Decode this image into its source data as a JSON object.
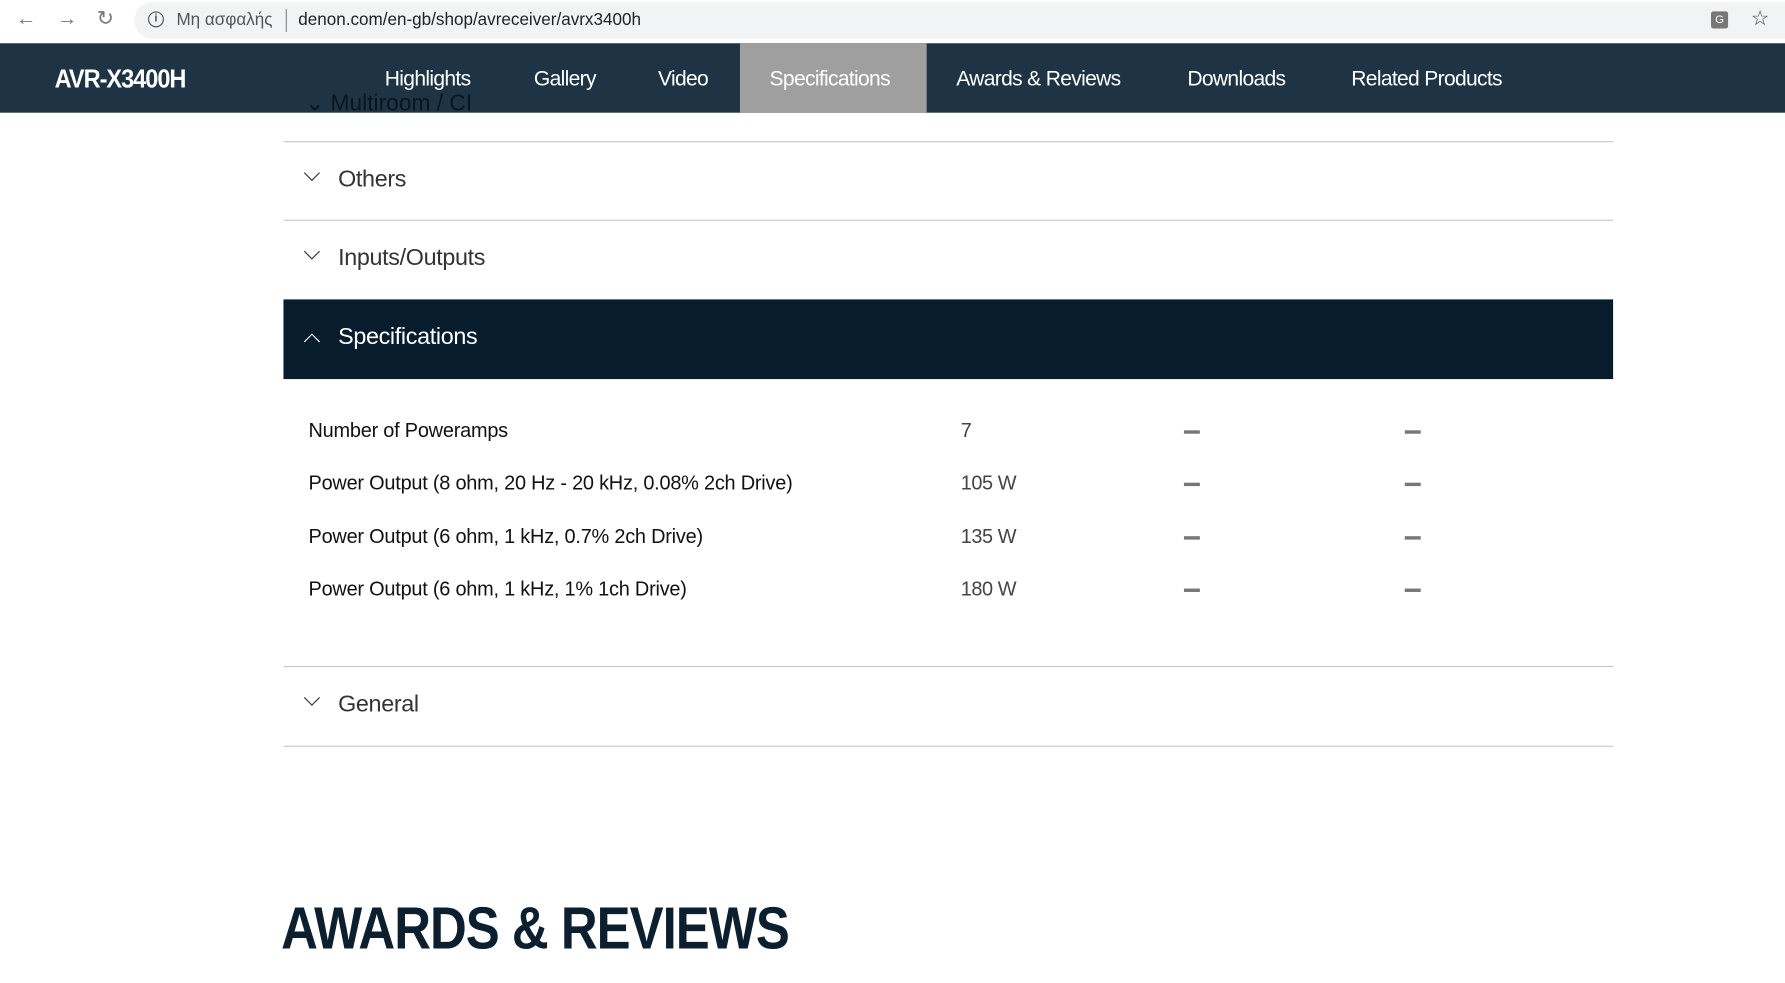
{
  "browser": {
    "security_label": "Μη ασφαλής",
    "url": "denon.com/en-gb/shop/avreceiver/avrx3400h"
  },
  "nav": {
    "brand": "AVR-X3400H",
    "tabs": [
      {
        "label": "Highlights"
      },
      {
        "label": "Gallery"
      },
      {
        "label": "Video"
      },
      {
        "label": "Specifications",
        "active": true
      },
      {
        "label": "Awards & Reviews"
      },
      {
        "label": "Downloads"
      },
      {
        "label": "Related Products"
      }
    ]
  },
  "sections": {
    "hidden": "Multiroom / CI",
    "others": "Others",
    "io": "Inputs/Outputs",
    "specs": "Specifications",
    "general": "General"
  },
  "specs": [
    {
      "label": "Number of Poweramps",
      "value": "7"
    },
    {
      "label": "Power Output (8 ohm, 20 Hz - 20 kHz, 0.08% 2ch Drive)",
      "value": "105 W"
    },
    {
      "label": "Power Output (6 ohm, 1 kHz, 0.7% 2ch Drive)",
      "value": "135 W"
    },
    {
      "label": "Power Output (6 ohm, 1 kHz, 1% 1ch Drive)",
      "value": "180 W"
    }
  ],
  "awards_heading": "AWARDS & REVIEWS",
  "colors": {
    "nav": "#1e3444",
    "active_tab": "#a09f9f",
    "open_section": "#071c2c"
  }
}
